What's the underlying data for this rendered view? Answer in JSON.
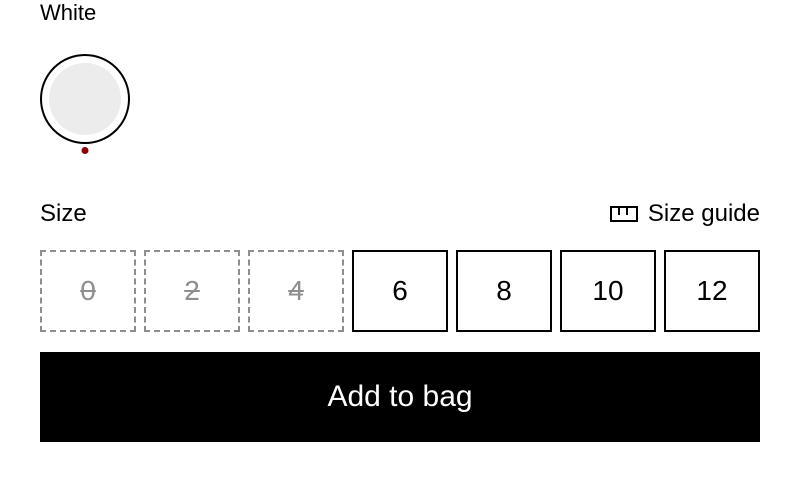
{
  "color": {
    "label": "White",
    "swatch_fill": "#ececec",
    "indicator_color": "#8b0000"
  },
  "size": {
    "label": "Size",
    "guide_label": "Size guide",
    "options": [
      {
        "label": "0",
        "available": false
      },
      {
        "label": "2",
        "available": false
      },
      {
        "label": "4",
        "available": false
      },
      {
        "label": "6",
        "available": true
      },
      {
        "label": "8",
        "available": true
      },
      {
        "label": "10",
        "available": true
      },
      {
        "label": "12",
        "available": true
      }
    ]
  },
  "cta": {
    "add_to_bag": "Add to bag"
  }
}
